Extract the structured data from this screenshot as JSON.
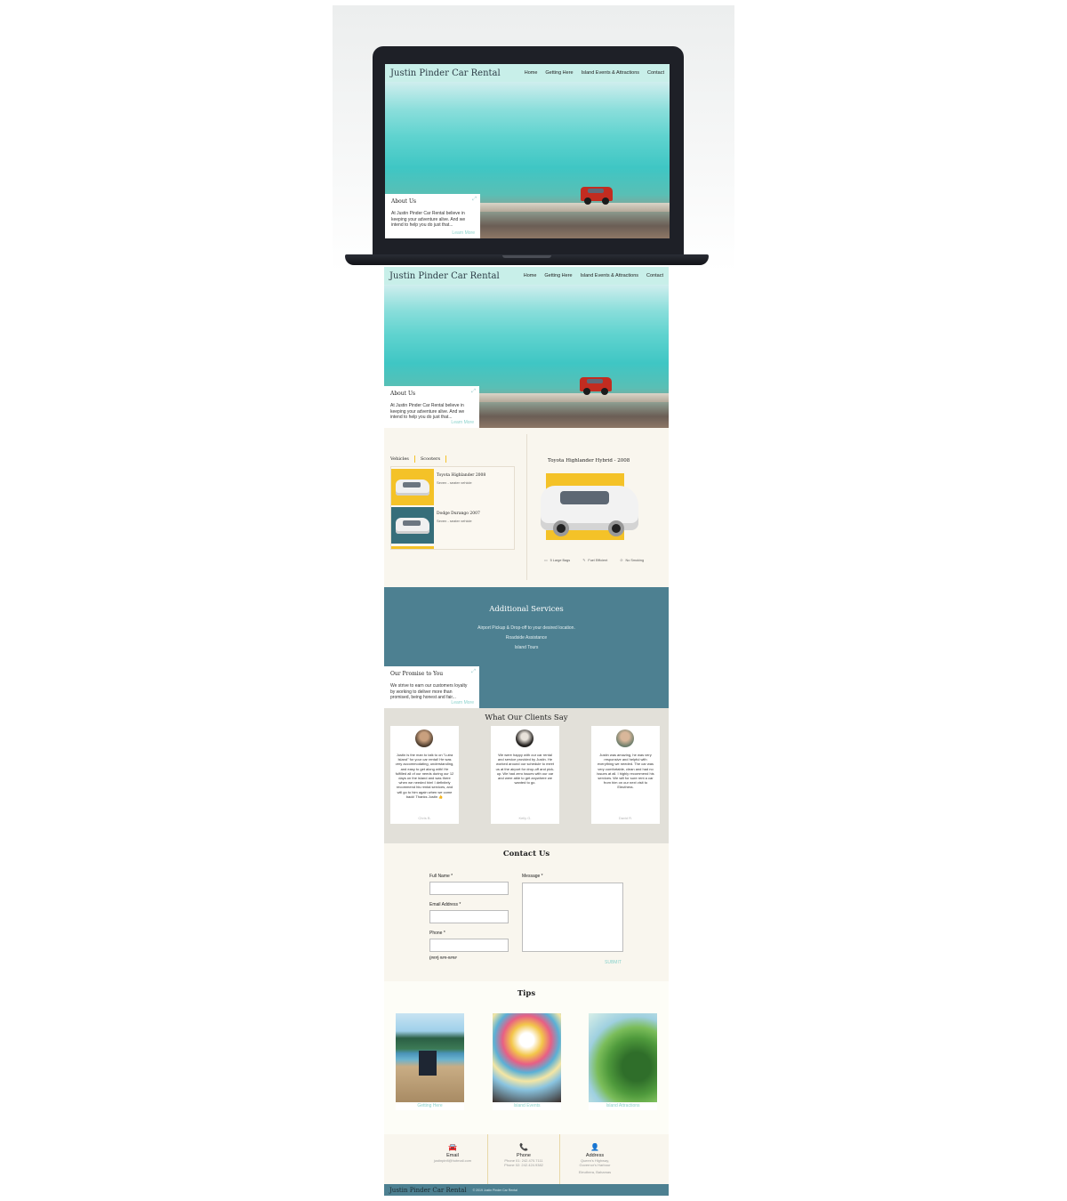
{
  "brand": "Justin Pinder Car Rental",
  "nav": [
    "Home",
    "Getting Here",
    "Island Events & Attractions",
    "Contact"
  ],
  "about": {
    "title": "About Us",
    "text": "At Justin Pinder Car Rental believe in keeping your adventure alive. And we intend to help you do just that...",
    "more": "Learn More"
  },
  "vehicles": {
    "tabs": [
      "Vehicles",
      "Scooters"
    ],
    "items": [
      {
        "name": "Toyota Highlander 2008",
        "sub": "Seven - seater vehicle",
        "color": "#f4c228"
      },
      {
        "name": "Dodge Durango 2007",
        "sub": "Seven - seater vehicle",
        "color": "#366e7a"
      }
    ],
    "featured": {
      "title": "Toyota Highlander Hybrid - 2008",
      "features": [
        "5 Large Bags",
        "Fuel Efficient",
        "No Smoking"
      ]
    }
  },
  "services": {
    "title": "Additional Services",
    "items": [
      "Airport Pickup & Drop-off to your desired location.",
      "Roadside Assistance",
      "Island Tours"
    ]
  },
  "promise": {
    "title": "Our Promise to You",
    "text": "We strive to earn our customers loyalty by working to deliver more than promised, being honest and fair...",
    "more": "Learn More"
  },
  "clients": {
    "title": "What Our Clients Say",
    "items": [
      {
        "text": "Justin is the man to talk to on \"Lutra Island\" for your car rental! He was very accommodating, understanding, and easy to get along with! He fulfilled all of our needs during our 12 days on the island and was there when we needed him! I definitely recommend his rental services, and will go to him again when we come back! Thanks Justin 👍",
        "name": "Chris B."
      },
      {
        "text": "We were happy with our car rental and service provided by Justin. He worked around our schedule to meet us at the airport for drop-off and pick-up. We had zero issues with our car and were able to get anywhere we wanted to go.",
        "name": "Kelly G."
      },
      {
        "text": "Justin was amazing, he was very responsive and helpful with everything we needed. The car was very comfortable, clean and had no issues at all. I highly recommend his services. We will for sure rent a car from him on our next visit to Eleuthera.",
        "name": "David R."
      }
    ]
  },
  "contact": {
    "title": "Contact Us",
    "full_name": "Full Name *",
    "email": "Email Address *",
    "phone": "Phone *",
    "phone_hint": "(###) ###-####",
    "message": "Message *",
    "submit": "SUBMIT"
  },
  "tips": {
    "title": "Tips",
    "items": [
      "Getting Here",
      "Island Events",
      "Island Attractions"
    ]
  },
  "info": {
    "email": {
      "icon": "🚘",
      "title": "Email",
      "lines": [
        "justinpinfi@hotmail.com"
      ]
    },
    "phone": {
      "icon": "📞",
      "title": "Phone",
      "lines": [
        "Phone 01: 242.470.7111",
        "Phone 02: 242.424.9382"
      ]
    },
    "address": {
      "icon": "👤",
      "title": "Address",
      "lines": [
        "Queen's Highway,",
        "Governor's Harbour",
        "Eleuthera, Bahamas"
      ]
    }
  },
  "footer": {
    "copyright": "© 2019 Justin Pinder Car Rental"
  }
}
